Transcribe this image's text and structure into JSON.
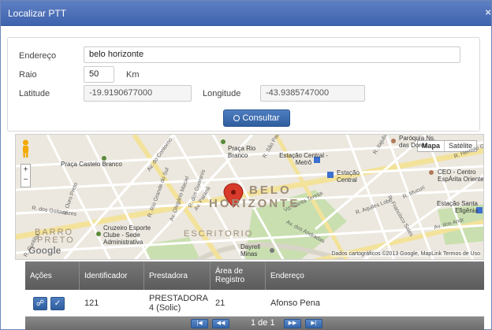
{
  "window": {
    "title": "Localizar PTT",
    "close_glyph": "×"
  },
  "form": {
    "endereco_label": "Endereço",
    "endereco_value": "belo horizonte",
    "raio_label": "Raio",
    "raio_value": "50",
    "raio_unit": "Km",
    "latitude_label": "Latitude",
    "latitude_value": "-19.9190677000",
    "longitude_label": "Longitude",
    "longitude_value": "-43.9385747000",
    "consultar_label": "Consultar",
    "consultar_icon": "search-icon"
  },
  "map": {
    "type_buttons": [
      "Mapa",
      "Satélite"
    ],
    "zoom_in": "+",
    "zoom_out": "−",
    "city_label_1": "BELO",
    "city_label_2": "HORIZONTE",
    "district_label": "ESCRITORIO",
    "barro_preto_1": "BARRO",
    "barro_preto_2": "PRETO",
    "places": {
      "praca_rio_branco": "Praça Rio Branco",
      "praca_castelo_branco": "Praça Castelo Branco",
      "estacao_central_metro": "Estação Central - Metrô",
      "estacao_central": "Estação Central",
      "ceo": "CEO - Centro EspÁrita Oriente",
      "estacao_santa_efigenia": "Estação Santa Efigênia",
      "cruzeiro": "Cruzeiro Esporte Clube - Sede Administrativa",
      "dayrell": "Dayrell Minas",
      "paroquia": "Paróquia Ns. das Dores"
    },
    "roads": {
      "av_do_contorno": "Av. do Contorno",
      "r_dos_goitacazes": "R. dos Goitacazes",
      "r_ouro_preto": "R. Ouro Preto",
      "r_rio_grande_do_sul": "R. Rio Grande do Sul",
      "av_olegario_maciel": "Av. Olegário Maciel",
      "av_parana": "Av. Paraná",
      "r_guaranis": "R. dos Guaranis",
      "r_sao_paulo": "R. São Paulo",
      "vd_santa_teresa": "Vd. Santa Teresa",
      "r_aquiles_lobo": "R. Aquiles Lobo",
      "av_dos_andradas": "Av. dos Andradas",
      "av_dos_andradas_2": "Av. dos Andr",
      "r_francisco_sales": "R. Francisco Sales",
      "r_mucuri": "R. Mucuri",
      "r_itajuba": "R. Itajubá",
      "r_hermilo": "R. Hermilo G",
      "r_curitiba": "R. Curitiba",
      "av_contorno_short": "Av. Co"
    },
    "google_logo": "Google",
    "attribution": "Dados cartográficos ©2013 Google, MapLink   Termos de Uso",
    "colors": {
      "park": "#c9dfb0",
      "road": "#ffffff",
      "main_road": "#f7e9a4",
      "marker": "#d83b2b"
    }
  },
  "grid": {
    "columns": [
      "Ações",
      "Identificador",
      "Prestadora",
      "Área de Registro",
      "Endereço"
    ],
    "rows": [
      {
        "actions": [
          "link-icon",
          "check-icon"
        ],
        "identificador": "121",
        "prestadora": "PRESTADORA 4 (Solic)",
        "area_registro": "21",
        "endereco": "Afonso Pena"
      }
    ]
  },
  "pager": {
    "first": "|◀",
    "prev": "◀◀",
    "info": "1 de 1",
    "next": "▶▶",
    "last": "▶|"
  }
}
